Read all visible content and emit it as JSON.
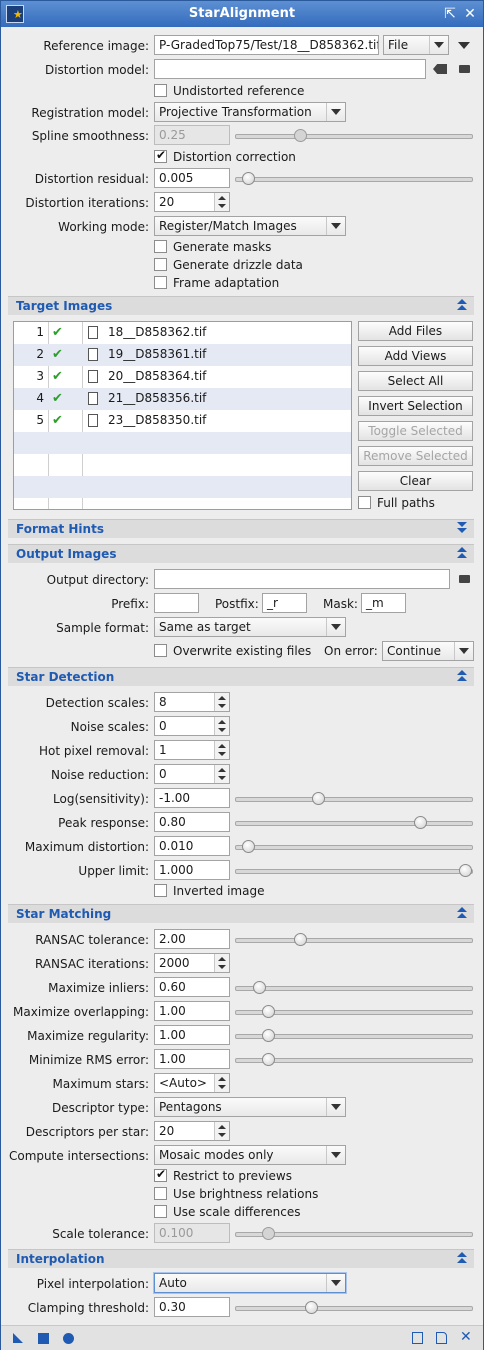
{
  "window": {
    "title": "StarAlignment"
  },
  "main": {
    "reference_image_label": "Reference image:",
    "reference_image_value": "P-GradedTop75/Test/18__D858362.tif",
    "reference_source": "File",
    "distortion_model_label": "Distortion model:",
    "distortion_model_value": "",
    "undistorted_reference": "Undistorted reference",
    "registration_model_label": "Registration model:",
    "registration_model_value": "Projective Transformation",
    "spline_smoothness_label": "Spline smoothness:",
    "spline_smoothness_value": "0.25",
    "distortion_correction": "Distortion correction",
    "distortion_residual_label": "Distortion residual:",
    "distortion_residual_value": "0.005",
    "distortion_iterations_label": "Distortion iterations:",
    "distortion_iterations_value": "20",
    "working_mode_label": "Working mode:",
    "working_mode_value": "Register/Match Images",
    "generate_masks": "Generate masks",
    "generate_drizzle": "Generate drizzle data",
    "frame_adaptation": "Frame adaptation"
  },
  "target_images": {
    "title": "Target Images",
    "files": [
      {
        "num": "1",
        "name": "18__D858362.tif"
      },
      {
        "num": "2",
        "name": "19__D858361.tif"
      },
      {
        "num": "3",
        "name": "20__D858364.tif"
      },
      {
        "num": "4",
        "name": "21__D858356.tif"
      },
      {
        "num": "5",
        "name": "23__D858350.tif"
      }
    ],
    "buttons": {
      "add_files": "Add Files",
      "add_views": "Add Views",
      "select_all": "Select All",
      "invert_selection": "Invert Selection",
      "toggle_selected": "Toggle Selected",
      "remove_selected": "Remove Selected",
      "clear": "Clear"
    },
    "full_paths": "Full paths"
  },
  "format_hints": {
    "title": "Format Hints"
  },
  "output_images": {
    "title": "Output Images",
    "output_directory_label": "Output directory:",
    "output_directory_value": "",
    "prefix_label": "Prefix:",
    "prefix_value": "",
    "postfix_label": "Postfix:",
    "postfix_value": "_r",
    "mask_label": "Mask:",
    "mask_value": "_m",
    "sample_format_label": "Sample format:",
    "sample_format_value": "Same as target",
    "overwrite": "Overwrite existing files",
    "on_error_label": "On error:",
    "on_error_value": "Continue"
  },
  "star_detection": {
    "title": "Star Detection",
    "detection_scales_label": "Detection scales:",
    "detection_scales_value": "8",
    "noise_scales_label": "Noise scales:",
    "noise_scales_value": "0",
    "hot_pixel_label": "Hot pixel removal:",
    "hot_pixel_value": "1",
    "noise_reduction_label": "Noise reduction:",
    "noise_reduction_value": "0",
    "log_sensitivity_label": "Log(sensitivity):",
    "log_sensitivity_value": "-1.00",
    "peak_response_label": "Peak response:",
    "peak_response_value": "0.80",
    "max_distortion_label": "Maximum distortion:",
    "max_distortion_value": "0.010",
    "upper_limit_label": "Upper limit:",
    "upper_limit_value": "1.000",
    "inverted_image": "Inverted image"
  },
  "star_matching": {
    "title": "Star Matching",
    "ransac_tolerance_label": "RANSAC tolerance:",
    "ransac_tolerance_value": "2.00",
    "ransac_iterations_label": "RANSAC iterations:",
    "ransac_iterations_value": "2000",
    "max_inliers_label": "Maximize inliers:",
    "max_inliers_value": "0.60",
    "max_overlapping_label": "Maximize overlapping:",
    "max_overlapping_value": "1.00",
    "max_regularity_label": "Maximize regularity:",
    "max_regularity_value": "1.00",
    "min_rms_label": "Minimize RMS error:",
    "min_rms_value": "1.00",
    "max_stars_label": "Maximum stars:",
    "max_stars_value": "<Auto>",
    "descriptor_type_label": "Descriptor type:",
    "descriptor_type_value": "Pentagons",
    "descriptors_per_star_label": "Descriptors per star:",
    "descriptors_per_star_value": "20",
    "compute_intersections_label": "Compute intersections:",
    "compute_intersections_value": "Mosaic modes only",
    "restrict_to_previews": "Restrict to previews",
    "use_brightness": "Use brightness relations",
    "use_scale_diff": "Use scale differences",
    "scale_tolerance_label": "Scale tolerance:",
    "scale_tolerance_value": "0.100"
  },
  "interpolation": {
    "title": "Interpolation",
    "pixel_interpolation_label": "Pixel interpolation:",
    "pixel_interpolation_value": "Auto",
    "clamping_label": "Clamping threshold:",
    "clamping_value": "0.30"
  },
  "slider_levels": {
    "spline_smoothness": 0.26,
    "distortion_residual": 0.03,
    "log_sensitivity": 0.34,
    "peak_response": 0.79,
    "max_distortion": 0.03,
    "upper_limit": 0.99,
    "ransac_tolerance": 0.26,
    "max_inliers": 0.08,
    "max_overlapping": 0.12,
    "max_regularity": 0.12,
    "min_rms": 0.12,
    "scale_tolerance": 0.12,
    "clamping": 0.31
  }
}
